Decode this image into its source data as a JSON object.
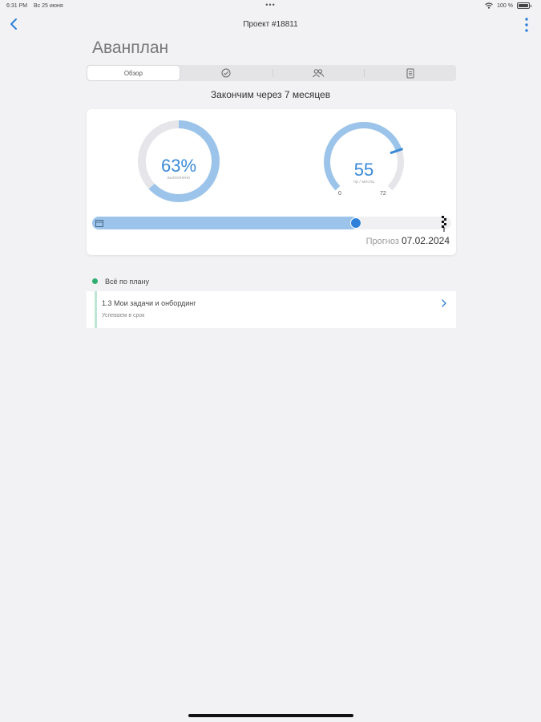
{
  "status_bar": {
    "time": "6:31 PM",
    "date": "Вс 25 июня",
    "center_dots": "•••",
    "battery": "100 %",
    "icons": [
      "wifi-icon",
      "battery-icon"
    ]
  },
  "nav": {
    "title": "Проект #18811",
    "back_icon": "chevron-left-icon",
    "more_icon": "vertical-dots-icon"
  },
  "page": {
    "title": "Аванплан"
  },
  "tabs": [
    {
      "label": "Обзор",
      "active": true
    },
    {
      "label": "",
      "icon": "checkmark-circle-icon"
    },
    {
      "label": "",
      "icon": "people-icon"
    },
    {
      "label": "",
      "icon": "document-icon"
    }
  ],
  "summary": {
    "finish_text": "Закончим через 7 месяцев"
  },
  "progress_card": {
    "completion": {
      "value": 0.63,
      "text": "63%",
      "label": "выполнено"
    },
    "velocity": {
      "value": 55,
      "text": "55",
      "label": "пр / месяц",
      "min": 0,
      "max": 72,
      "min_text": "0",
      "max_text": "72"
    },
    "timeline": {
      "progress": 0.74,
      "start_icon": "calendar-icon",
      "end_icon": "finish-flag-icon"
    },
    "forecast_label": "Прогноз",
    "forecast_date": "07.02.2024"
  },
  "timeline_section": {
    "status": "Всё по плану",
    "status_color": "#2eae6f",
    "task": {
      "title": "1.3 Мои задачи и онбординг",
      "subtitle": "Успеваем в срок"
    }
  },
  "colors": {
    "accent": "#3a8ad6",
    "accent_light": "#9cc4ea",
    "track": "#e6e6ea"
  }
}
